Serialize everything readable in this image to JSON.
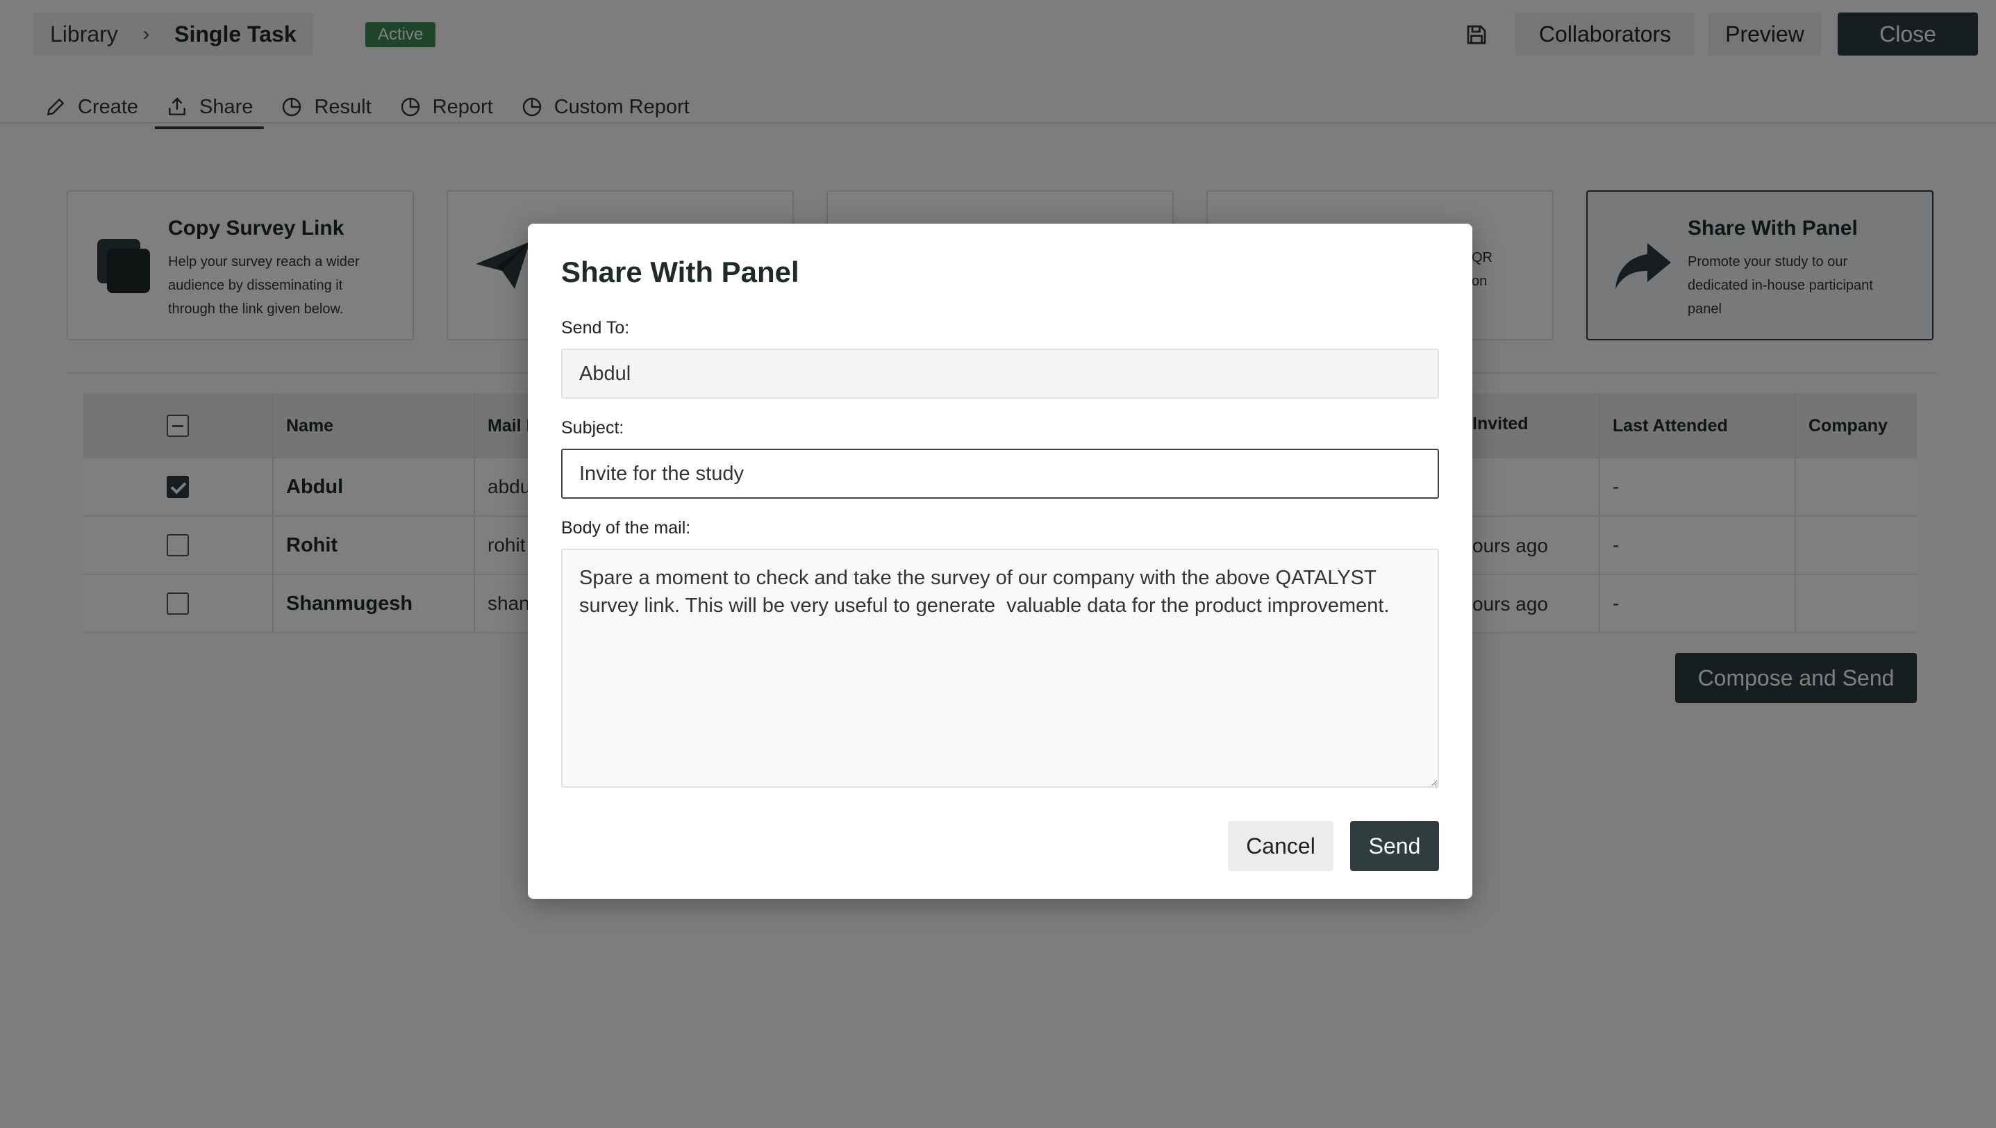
{
  "header": {
    "breadcrumb_root": "Library",
    "breadcrumb_separator": "›",
    "breadcrumb_current": "Single Task",
    "status_badge": "Active",
    "collaborators_label": "Collaborators",
    "preview_label": "Preview",
    "close_label": "Close"
  },
  "tabs": [
    {
      "label": "Create",
      "icon": "pencil-icon"
    },
    {
      "label": "Share",
      "icon": "share-upload-icon",
      "active": true
    },
    {
      "label": "Result",
      "icon": "pie-chart-icon"
    },
    {
      "label": "Report",
      "icon": "pie-chart-icon"
    },
    {
      "label": "Custom Report",
      "icon": "pie-chart-icon"
    }
  ],
  "cards": {
    "copy_link": {
      "title": "Copy Survey Link",
      "description": "Help your survey reach a wider audience by disseminating it through the link given below."
    },
    "qr_fragment_1": "QR",
    "qr_fragment_2": "on",
    "panel": {
      "title": "Share With Panel",
      "description": "Promote your study to our dedicated in-house participant panel"
    }
  },
  "table": {
    "headers": {
      "name": "Name",
      "mail_fragment": "Mail I",
      "invited_fragment": "Invited",
      "last_attended": "Last Attended",
      "company": "Company"
    },
    "rows": [
      {
        "name": "Abdul",
        "mail_fragment": "abdu",
        "invited_fragment": "",
        "last_attended": "-",
        "checked": true
      },
      {
        "name": "Rohit",
        "mail_fragment": "rohit",
        "invited_fragment": "ours ago",
        "last_attended": "-",
        "checked": false
      },
      {
        "name": "Shanmugesh",
        "mail_fragment": "shan",
        "invited_fragment": "ours ago",
        "last_attended": "-",
        "checked": false
      }
    ],
    "compose_label": "Compose and Send"
  },
  "modal": {
    "title": "Share With Panel",
    "send_to_label": "Send To:",
    "send_to_value": "Abdul",
    "subject_label": "Subject:",
    "subject_value": "Invite for the study",
    "body_label": "Body of the mail:",
    "body_value": "Spare a moment to check and take the survey of our company with the above QATALYST survey link. This will be very useful to generate  valuable data for the product improvement.",
    "cancel_label": "Cancel",
    "send_label": "Send"
  },
  "colors": {
    "primary_dark": "#2f3d3e",
    "active_badge": "#3d8a55",
    "overlay": "rgba(0,0,0,0.5)"
  }
}
